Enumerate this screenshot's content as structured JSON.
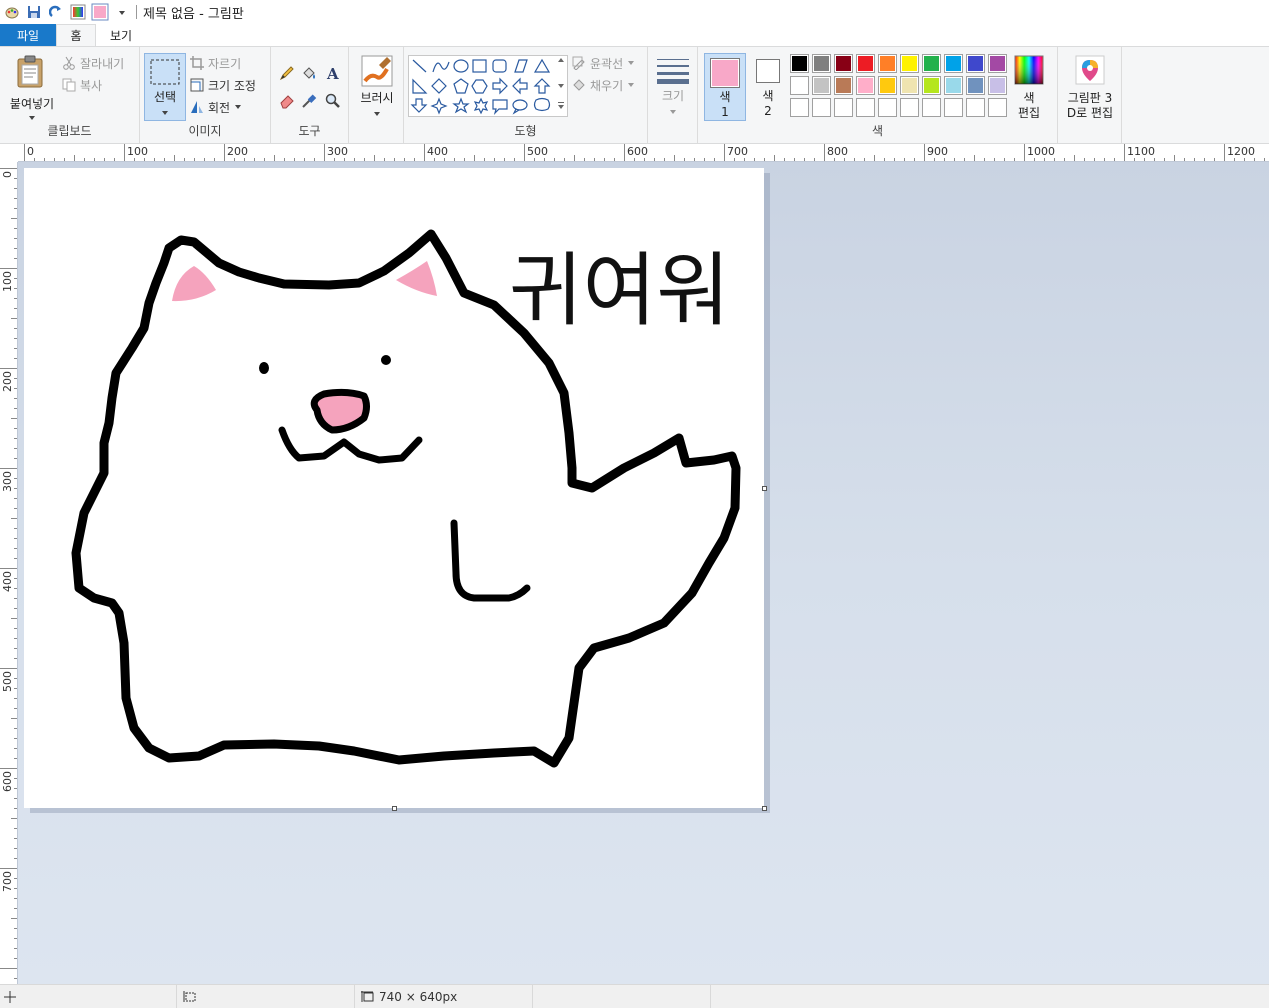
{
  "titlebar": {
    "title": "제목 없음 - 그림판"
  },
  "tabs": {
    "file": "파일",
    "home": "홈",
    "view": "보기"
  },
  "clipboard": {
    "paste": "붙여넣기",
    "cut": "잘라내기",
    "copy": "복사",
    "label": "클립보드"
  },
  "image": {
    "select": "선택",
    "crop": "자르기",
    "resize": "크기 조정",
    "rotate": "회전",
    "label": "이미지"
  },
  "tools": {
    "label": "도구"
  },
  "brushes": {
    "label": "브러시"
  },
  "shapes": {
    "outline": "윤곽선",
    "fill": "채우기",
    "label": "도형"
  },
  "size": {
    "label": "크기"
  },
  "colors": {
    "color1_label": "색",
    "color1_num": "1",
    "color2_label": "색",
    "color2_num": "2",
    "edit_line1": "색",
    "edit_line2": "편집",
    "label": "색",
    "color1": "#f8a8c8",
    "color2": "#ffffff",
    "palette_row1": [
      "#000000",
      "#7f7f7f",
      "#880015",
      "#ed1c24",
      "#ff7f27",
      "#fff200",
      "#22b14c",
      "#00a2e8",
      "#3f48cc",
      "#a349a4"
    ],
    "palette_row2": [
      "#ffffff",
      "#c3c3c3",
      "#b97a57",
      "#ffaec9",
      "#ffc90e",
      "#efe4b0",
      "#b5e61d",
      "#99d9ea",
      "#7092be",
      "#c8bfe7"
    ],
    "palette_row3": [
      "#ffffff",
      "#ffffff",
      "#ffffff",
      "#ffffff",
      "#ffffff",
      "#ffffff",
      "#ffffff",
      "#ffffff",
      "#ffffff",
      "#ffffff"
    ]
  },
  "paint3d": {
    "line1": "그림판 3",
    "line2": "D로 편집"
  },
  "ruler": {
    "top_ticks": [
      "0",
      "100",
      "200",
      "300",
      "400",
      "500",
      "600",
      "700",
      "800",
      "900",
      "1000",
      "1100",
      "1200"
    ],
    "left_ticks": [
      "0",
      "100",
      "200",
      "300",
      "400",
      "500",
      "600",
      "700"
    ]
  },
  "drawing": {
    "caption": "귀여워"
  },
  "status": {
    "canvas_size": "740 × 640px"
  }
}
